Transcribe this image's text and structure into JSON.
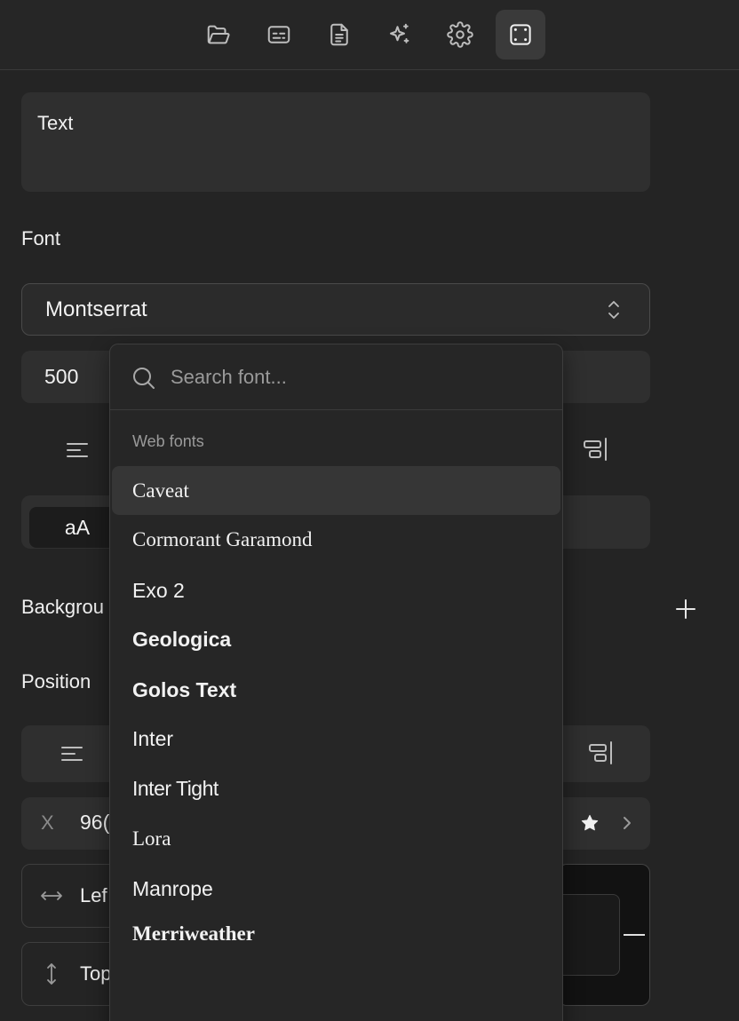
{
  "toolbar": {
    "tabs": [
      {
        "icon": "folder-icon"
      },
      {
        "icon": "subtitles-icon"
      },
      {
        "icon": "document-icon"
      },
      {
        "icon": "sparkles-icon"
      },
      {
        "icon": "gear-icon"
      },
      {
        "icon": "frame-icon",
        "active": true
      }
    ]
  },
  "text_field": {
    "value": "Text"
  },
  "font_section": {
    "label": "Font",
    "selected_font": "Montserrat",
    "weight": "500"
  },
  "case_toggle": {
    "active_label": "aA"
  },
  "background_section": {
    "label": "Backgrou"
  },
  "position_section": {
    "label": "Position",
    "x_label": "X",
    "x_value": "96(",
    "left_label": "Lef",
    "top_label": "Top"
  },
  "font_dropdown": {
    "search_placeholder": "Search font...",
    "group_label": "Web fonts",
    "items": [
      "Caveat",
      "Cormorant Garamond",
      "Exo 2",
      "Geologica",
      "Golos Text",
      "Inter",
      "Inter Tight",
      "Lora",
      "Manrope",
      "Merriweather"
    ],
    "highlighted": "Caveat"
  }
}
